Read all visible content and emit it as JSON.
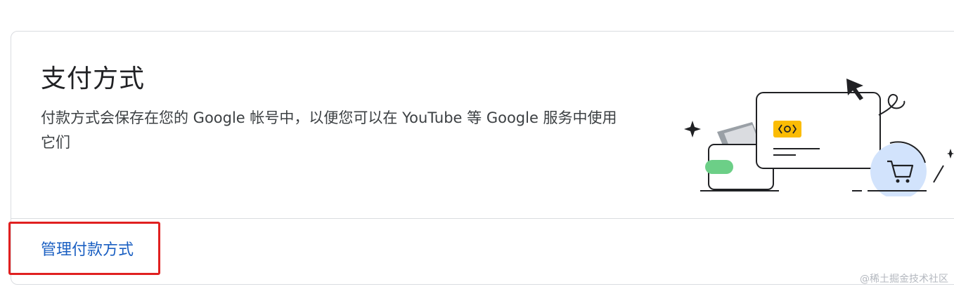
{
  "card": {
    "title": "支付方式",
    "description": "付款方式会保存在您的 Google 帐号中，以便您可以在 YouTube 等 Google 服务中使用它们",
    "manage_link": "管理付款方式"
  },
  "illustration": {
    "icon": "payment-cards-cart-illustration",
    "colors": {
      "chip": "#fbbc04",
      "green_card": "#6ccf87",
      "cart_circle": "#d2e3fc",
      "stroke": "#202124"
    }
  },
  "highlight": {
    "color": "#e02020"
  },
  "watermark": "@稀土掘金技术社区"
}
